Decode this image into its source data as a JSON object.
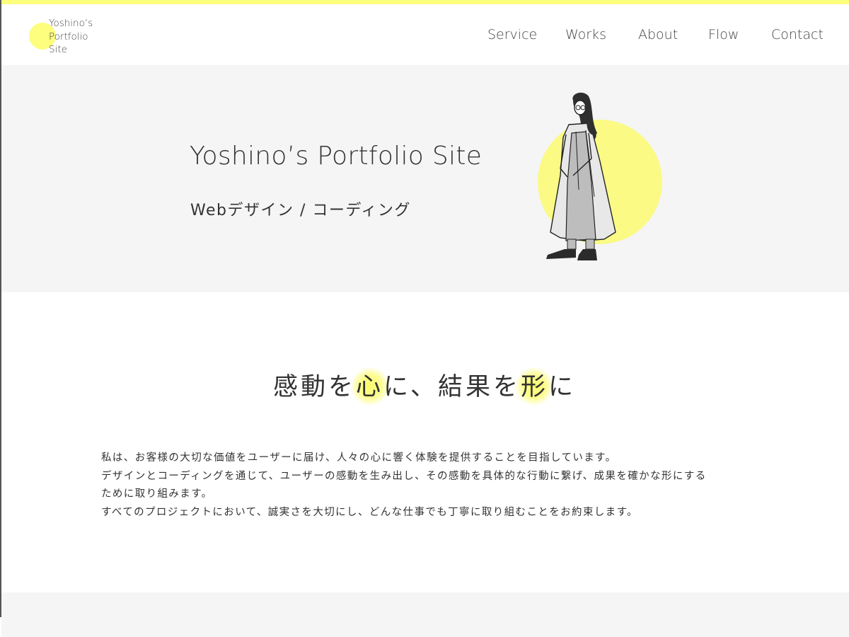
{
  "colors": {
    "accent": "#fdfd7e",
    "hero_bg": "#f5f5f5",
    "text": "#333333"
  },
  "header": {
    "logo_lines": [
      "Yoshino’s",
      "Portfolio",
      "Site"
    ],
    "nav": [
      "Service",
      "Works",
      "About",
      "Flow",
      "Contact"
    ]
  },
  "hero": {
    "title": "Yoshino’s Portfolio Site",
    "subtitle": "Webデザイン / コーディング",
    "illustration": "woman-in-long-coat-illustration"
  },
  "message": {
    "catch_parts": [
      "感動を",
      "心",
      "に、結果を",
      "形",
      "に"
    ],
    "lines": [
      "私は、お客様の大切な価値をユーザーに届け、人々の心に響く体験を提供することを目指しています。",
      "デザインとコーディングを通じて、ユーザーの感動を生み出し、その感動を具体的な行動に繋げ、成果を確かな形にする",
      "ために取り組みます。",
      "すべてのプロジェクトにおいて、誠実さを大切にし、どんな仕事でも丁寧に取り組むことをお約束します。"
    ]
  }
}
